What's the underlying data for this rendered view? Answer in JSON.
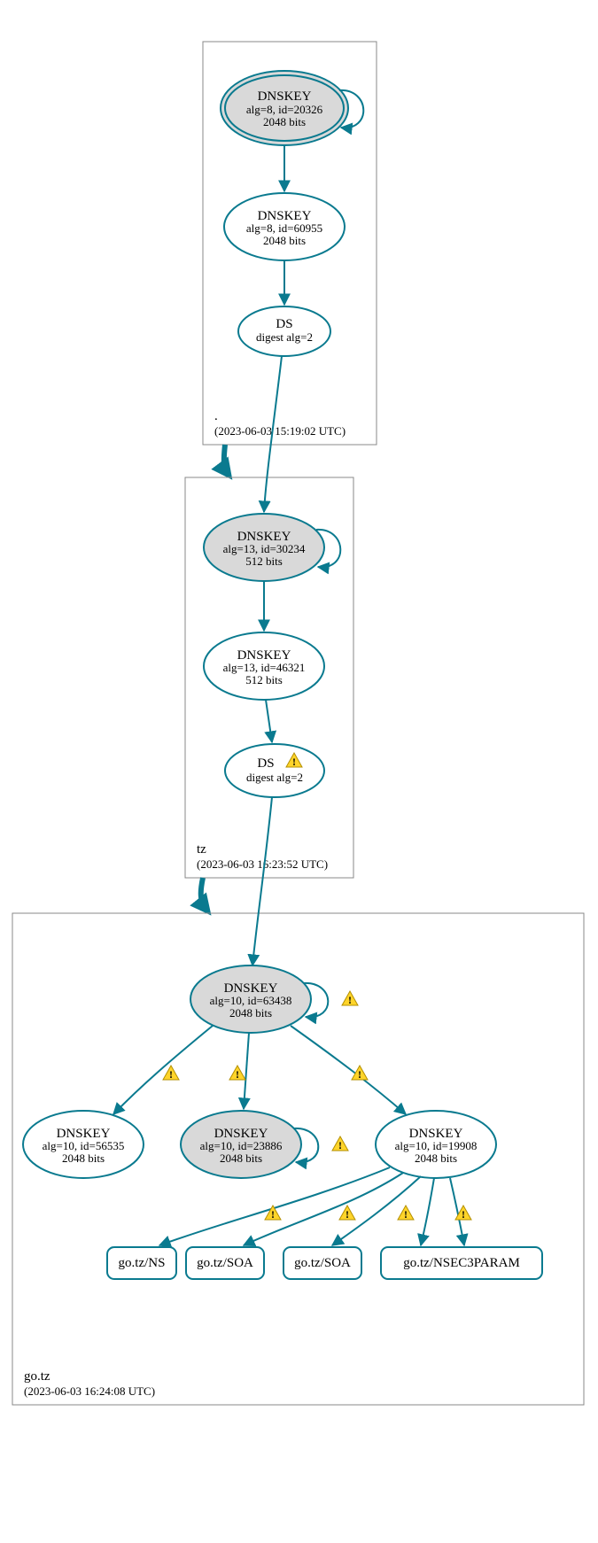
{
  "colors": {
    "edge": "#0a7a8f",
    "sep_fill": "#d9d9d9",
    "warn": "#ffd42a"
  },
  "zones": {
    "root": {
      "label": ".",
      "timestamp": "(2023-06-03 15:19:02 UTC)"
    },
    "tz": {
      "label": "tz",
      "timestamp": "(2023-06-03 16:23:52 UTC)"
    },
    "gotz": {
      "label": "go.tz",
      "timestamp": "(2023-06-03 16:24:08 UTC)"
    }
  },
  "nodes": {
    "root_ksk": {
      "title": "DNSKEY",
      "line2": "alg=8, id=20326",
      "line3": "2048 bits"
    },
    "root_zsk": {
      "title": "DNSKEY",
      "line2": "alg=8, id=60955",
      "line3": "2048 bits"
    },
    "root_ds": {
      "title": "DS",
      "line2": "digest alg=2"
    },
    "tz_ksk": {
      "title": "DNSKEY",
      "line2": "alg=13, id=30234",
      "line3": "512 bits"
    },
    "tz_zsk": {
      "title": "DNSKEY",
      "line2": "alg=13, id=46321",
      "line3": "512 bits"
    },
    "tz_ds": {
      "title": "DS",
      "line2": "digest alg=2"
    },
    "gotz_ksk": {
      "title": "DNSKEY",
      "line2": "alg=10, id=63438",
      "line3": "2048 bits"
    },
    "gotz_k1": {
      "title": "DNSKEY",
      "line2": "alg=10, id=56535",
      "line3": "2048 bits"
    },
    "gotz_k2": {
      "title": "DNSKEY",
      "line2": "alg=10, id=23886",
      "line3": "2048 bits"
    },
    "gotz_k3": {
      "title": "DNSKEY",
      "line2": "alg=10, id=19908",
      "line3": "2048 bits"
    }
  },
  "rr": {
    "ns": {
      "label": "go.tz/NS"
    },
    "soa1": {
      "label": "go.tz/SOA"
    },
    "soa2": {
      "label": "go.tz/SOA"
    },
    "nsec3": {
      "label": "go.tz/NSEC3PARAM"
    }
  }
}
